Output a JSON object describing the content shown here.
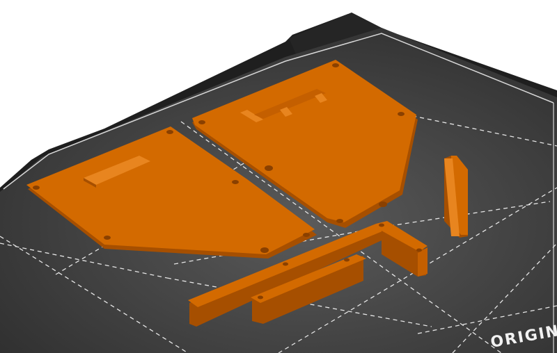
{
  "bed": {
    "label": "ORIGIN",
    "plate_color": "#3a3a3a",
    "frame_color": "#1e1e1e",
    "grid_color": "#e6e6e6"
  },
  "parts": {
    "color": "#d36a00",
    "shade_color": "#a64f00",
    "highlight_color": "#e8851f",
    "items": [
      {
        "name": "left-plate"
      },
      {
        "name": "right-plate"
      },
      {
        "name": "long-bracket"
      },
      {
        "name": "short-bar"
      },
      {
        "name": "upright-tab"
      }
    ]
  }
}
